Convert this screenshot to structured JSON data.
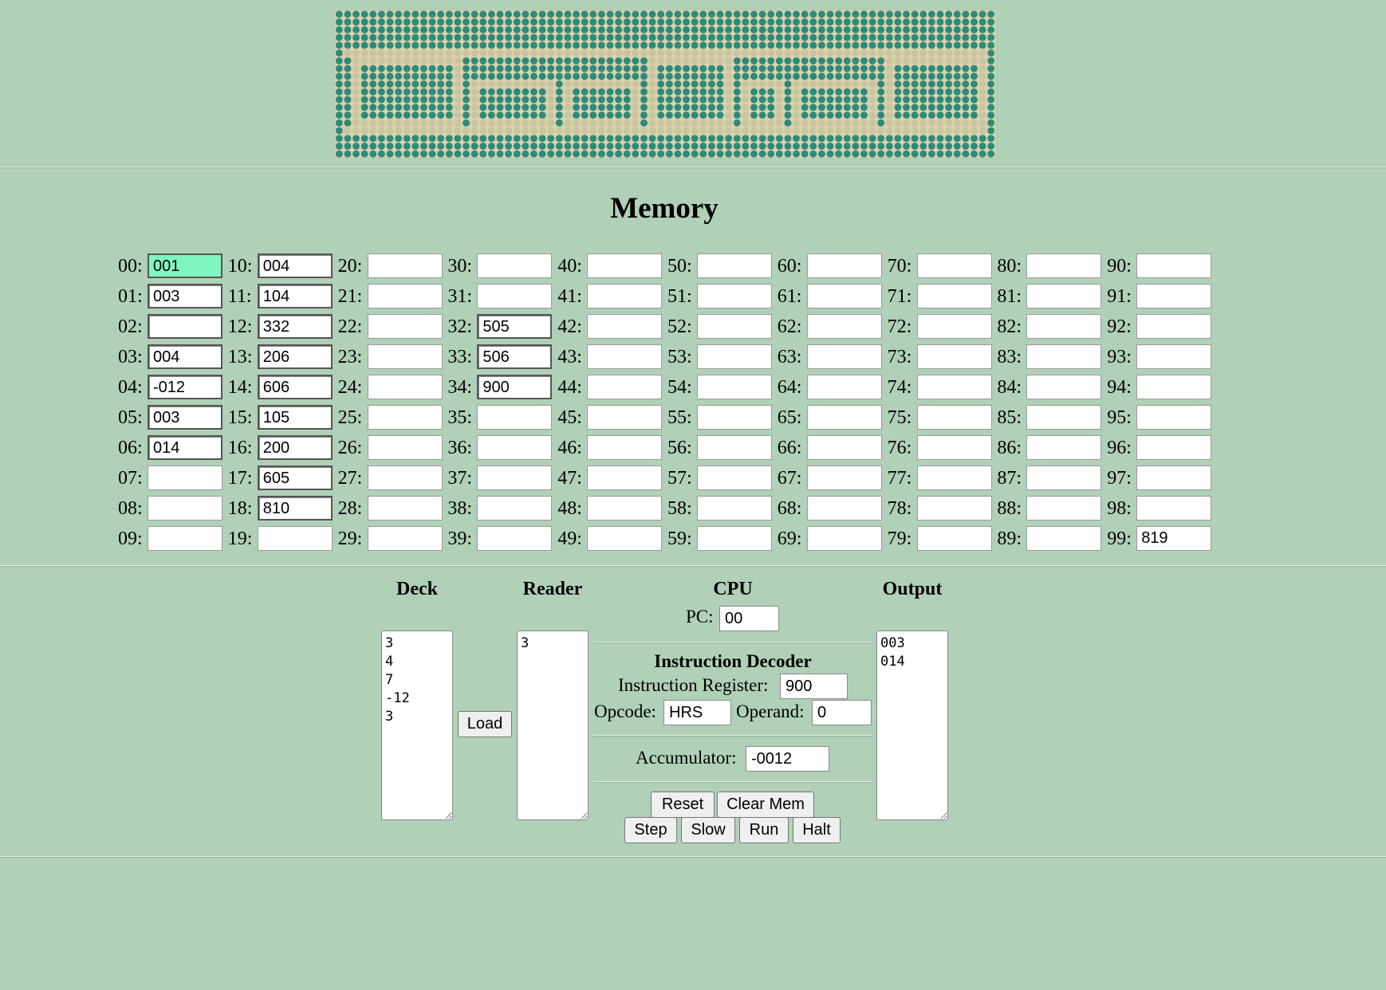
{
  "memory": {
    "title": "Memory",
    "cells": [
      [
        "001",
        "003",
        "",
        "004",
        "-012",
        "003",
        "014",
        "",
        "",
        ""
      ],
      [
        "004",
        "104",
        "332",
        "206",
        "606",
        "105",
        "200",
        "605",
        "810",
        ""
      ],
      [
        "",
        "",
        "",
        "",
        "",
        "",
        "",
        "",
        "",
        ""
      ],
      [
        "",
        "",
        "505",
        "506",
        "900",
        "",
        "",
        "",
        "",
        ""
      ],
      [
        "",
        "",
        "",
        "",
        "",
        "",
        "",
        "",
        "",
        ""
      ],
      [
        "",
        "",
        "",
        "",
        "",
        "",
        "",
        "",
        "",
        ""
      ],
      [
        "",
        "",
        "",
        "",
        "",
        "",
        "",
        "",
        "",
        ""
      ],
      [
        "",
        "",
        "",
        "",
        "",
        "",
        "",
        "",
        "",
        ""
      ],
      [
        "",
        "",
        "",
        "",
        "",
        "",
        "",
        "",
        "",
        ""
      ],
      [
        "",
        "",
        "",
        "",
        "",
        "",
        "",
        "",
        "",
        "819"
      ]
    ]
  },
  "deck": {
    "title": "Deck",
    "content": "3\n4\n7\n-12\n3",
    "load_label": "Load"
  },
  "reader": {
    "title": "Reader",
    "content": "3"
  },
  "cpu": {
    "title": "CPU",
    "pc_label": "PC:",
    "pc_value": "00",
    "decoder_title": "Instruction Decoder",
    "ir_label": "Instruction Register:",
    "ir_value": "900",
    "opcode_label": "Opcode:",
    "opcode_value": "HRS",
    "operand_label": "Operand:",
    "operand_value": "0",
    "acc_label": "Accumulator:",
    "acc_value": "-0012",
    "buttons": {
      "reset": "Reset",
      "clear": "Clear Mem",
      "step": "Step",
      "slow": "Slow",
      "run": "Run",
      "halt": "Halt"
    }
  },
  "output": {
    "title": "Output",
    "content": "003\n014"
  }
}
